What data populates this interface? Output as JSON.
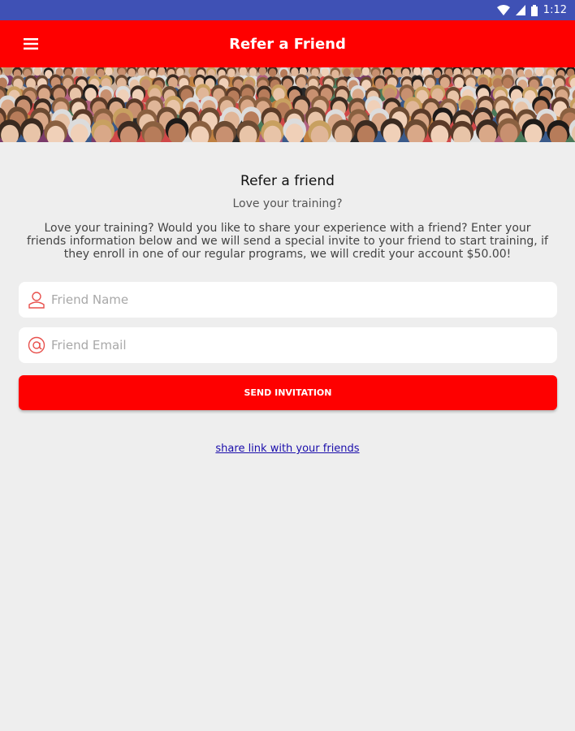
{
  "status_bar": {
    "time": "1:12",
    "icons": [
      "wifi-icon",
      "signal-icon",
      "battery-icon"
    ]
  },
  "toolbar": {
    "title": "Refer a Friend",
    "menu_icon": "menu-icon"
  },
  "banner": {
    "image": "crowd-photo"
  },
  "content": {
    "heading": "Refer a friend",
    "subheading": "Love your training?",
    "description": "Love your training? Would you like to share your experience with a friend? Enter your friends information below and we will send a special invite to your friend to start training, if they enroll in one of our regular programs, we will credit your account $50.00!"
  },
  "form": {
    "name_placeholder": "Friend Name",
    "name_value": "",
    "name_icon": "person-icon",
    "email_placeholder": "Friend Email",
    "email_value": "",
    "email_icon": "at-sign-icon",
    "send_label": "SEND INVITATION"
  },
  "share_link": "share link with your friends",
  "colors": {
    "accent": "#fe0000",
    "status_bar": "#3f51b5",
    "background": "#eeeeee",
    "link": "#1a0dab"
  }
}
